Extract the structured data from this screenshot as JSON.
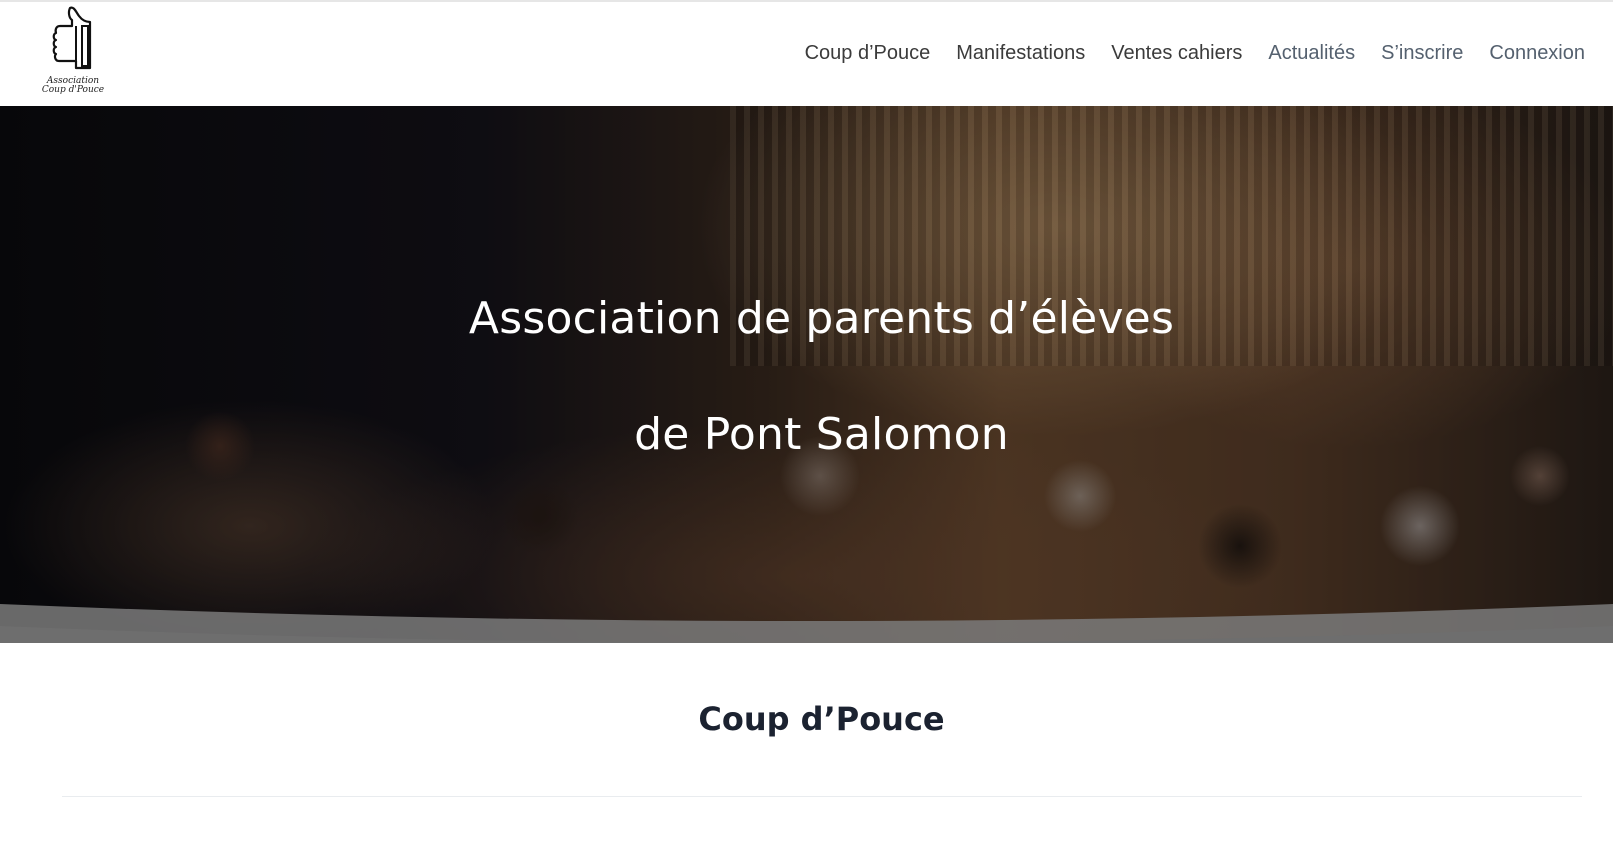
{
  "logo": {
    "icon": "thumbs-up-icon",
    "line1": "Association",
    "line2": "Coup d'Pouce"
  },
  "nav": {
    "items": [
      {
        "label": "Coup d’Pouce"
      },
      {
        "label": "Manifestations"
      },
      {
        "label": "Ventes cahiers"
      },
      {
        "label": "Actualités"
      },
      {
        "label": "S’inscrire"
      },
      {
        "label": "Connexion"
      }
    ]
  },
  "hero": {
    "line1": "Association de parents d’élèves",
    "line2": "de Pont Salomon"
  },
  "section": {
    "title": "Coup d’Pouce"
  }
}
